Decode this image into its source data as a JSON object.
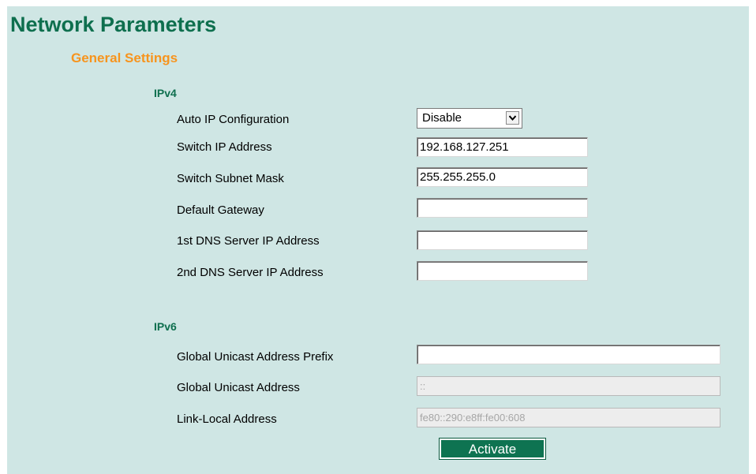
{
  "page": {
    "title": "Network Parameters",
    "section_title": "General Settings"
  },
  "ipv4": {
    "heading": "IPv4",
    "auto_ip": {
      "label": "Auto IP Configuration",
      "value": "Disable"
    },
    "switch_ip": {
      "label": "Switch IP Address",
      "value": "192.168.127.251"
    },
    "subnet_mask": {
      "label": "Switch Subnet Mask",
      "value": "255.255.255.0"
    },
    "default_gateway": {
      "label": "Default Gateway",
      "value": ""
    },
    "dns1": {
      "label": "1st DNS Server IP Address",
      "value": ""
    },
    "dns2": {
      "label": "2nd DNS Server IP Address",
      "value": ""
    }
  },
  "ipv6": {
    "heading": "IPv6",
    "global_prefix": {
      "label": "Global Unicast Address Prefix",
      "value": ""
    },
    "global_address": {
      "label": "Global Unicast Address",
      "value": "::"
    },
    "link_local": {
      "label": "Link-Local Address",
      "value": "fe80::290:e8ff:fe00:608"
    }
  },
  "actions": {
    "activate_label": "Activate"
  },
  "colors": {
    "panel_bg": "#cfe6e4",
    "title_green": "#0e6f4e",
    "section_orange": "#f7941d",
    "button_green": "#0e7351"
  },
  "icons": {
    "dropdown": "chevron-down-icon"
  }
}
